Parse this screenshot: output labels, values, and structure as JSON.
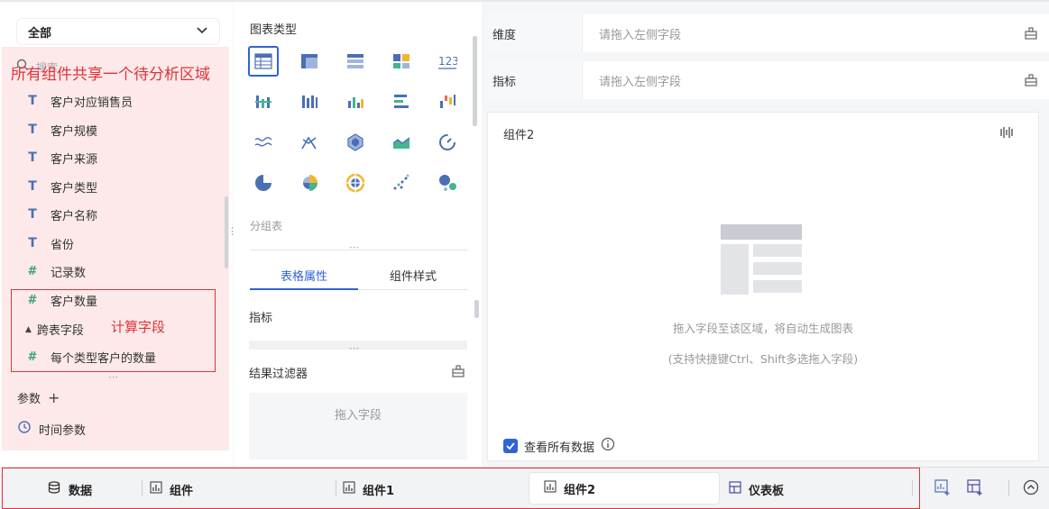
{
  "left_panel": {
    "scope_select": {
      "value": "全部"
    },
    "search": {
      "placeholder": "搜索"
    },
    "annotation_shared": "所有组件共享一个待分析区域",
    "fields": [
      {
        "label": "客户对应销售员",
        "type": "text"
      },
      {
        "label": "客户规模",
        "type": "text"
      },
      {
        "label": "客户来源",
        "type": "text"
      },
      {
        "label": "客户类型",
        "type": "text"
      },
      {
        "label": "客户名称",
        "type": "text"
      },
      {
        "label": "省份",
        "type": "text"
      },
      {
        "label": "记录数",
        "type": "number"
      },
      {
        "label": "客户数量",
        "type": "calc"
      }
    ],
    "group": {
      "label": "跨表字段",
      "fields": [
        {
          "label": "每个类型客户的数量",
          "type": "calc"
        }
      ]
    },
    "annotation_calc": "计算字段",
    "params": {
      "label": "参数",
      "add_icon": "plus-icon"
    },
    "time_param": {
      "label": "时间参数"
    }
  },
  "middle_panel": {
    "chart_type_title": "图表类型",
    "chart_icons": [
      "table",
      "cross-table",
      "detail-table",
      "kpi-card",
      "number",
      "grouped-bar",
      "stacked-bar",
      "column",
      "horizontal-bar",
      "waterfall",
      "line",
      "multi-line",
      "radar",
      "area",
      "gauge",
      "pie",
      "rose",
      "sunburst",
      "scatter",
      "bubble"
    ],
    "current_type": "分组表",
    "tabs": [
      "表格属性",
      "组件样式"
    ],
    "metric_label": "指标",
    "filter": {
      "label": "结果过滤器",
      "drop_placeholder": "拖入字段"
    }
  },
  "right_panel": {
    "dimension": {
      "label": "维度",
      "placeholder": "请拖入左侧字段"
    },
    "measure": {
      "label": "指标",
      "placeholder": "请拖入左侧字段"
    },
    "canvas": {
      "title": "组件2",
      "hint": "拖入字段至该区域，将自动生成图表",
      "hint_sub": "(支持快捷键Ctrl、Shift多选拖入字段)",
      "view_all": {
        "label": "查看所有数据",
        "checked": true
      }
    }
  },
  "bottom_tabs": [
    {
      "label": "数据",
      "icon": "database-icon",
      "active": false
    },
    {
      "label": "组件",
      "icon": "chart-icon",
      "active": false
    },
    {
      "label": "组件1",
      "icon": "chart-icon",
      "active": false
    },
    {
      "label": "组件2",
      "icon": "chart-icon",
      "active": true
    },
    {
      "label": "仪表板",
      "icon": "dashboard-icon",
      "active": false
    }
  ],
  "colors": {
    "accent": "#2f64d6",
    "annotation": "#e0333a",
    "highlight_bg": "#fde9e9"
  }
}
